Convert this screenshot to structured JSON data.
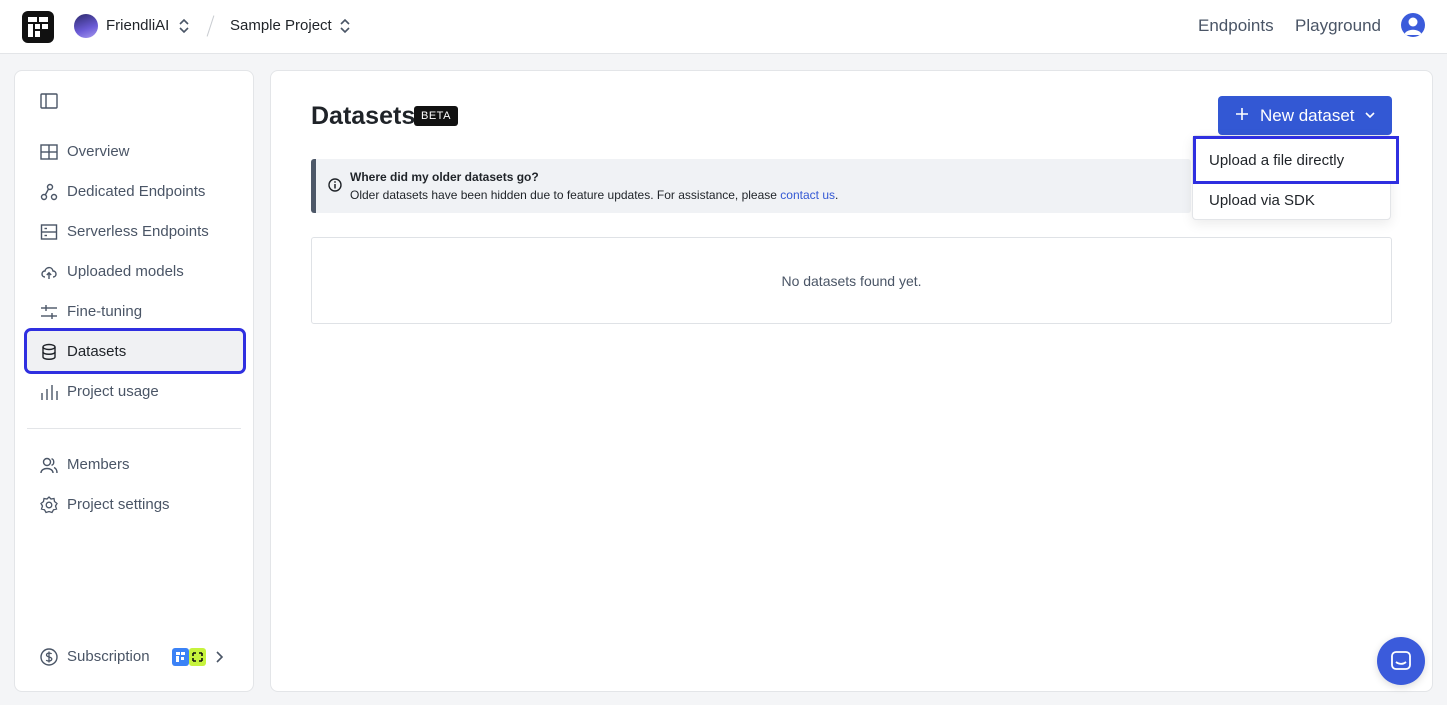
{
  "topbar": {
    "org_name": "FriendliAI",
    "project_name": "Sample Project",
    "nav": [
      "Endpoints",
      "Playground"
    ]
  },
  "sidebar": {
    "items": [
      {
        "label": "Overview",
        "icon": "layout-grid-icon"
      },
      {
        "label": "Dedicated Endpoints",
        "icon": "nodes-icon"
      },
      {
        "label": "Serverless Endpoints",
        "icon": "server-list-icon"
      },
      {
        "label": "Uploaded models",
        "icon": "cloud-upload-icon"
      },
      {
        "label": "Fine-tuning",
        "icon": "sliders-icon"
      },
      {
        "label": "Datasets",
        "icon": "database-icon",
        "active": true
      },
      {
        "label": "Project usage",
        "icon": "bar-chart-icon"
      }
    ],
    "secondary": [
      {
        "label": "Members",
        "icon": "users-icon"
      },
      {
        "label": "Project settings",
        "icon": "gear-icon"
      }
    ],
    "subscription_label": "Subscription"
  },
  "main": {
    "title": "Datasets",
    "badge": "BETA",
    "new_button_label": "New dataset",
    "notice": {
      "title": "Where did my older datasets go?",
      "body": "Older datasets have been hidden due to feature updates. For assistance, please ",
      "link": "contact us",
      "tail": "."
    },
    "empty_message": "No datasets found yet."
  },
  "dropdown": {
    "items": [
      "Upload a file directly",
      "Upload via SDK"
    ]
  },
  "colors": {
    "accent": "#3358d4",
    "highlight": "#2f2fe0"
  }
}
